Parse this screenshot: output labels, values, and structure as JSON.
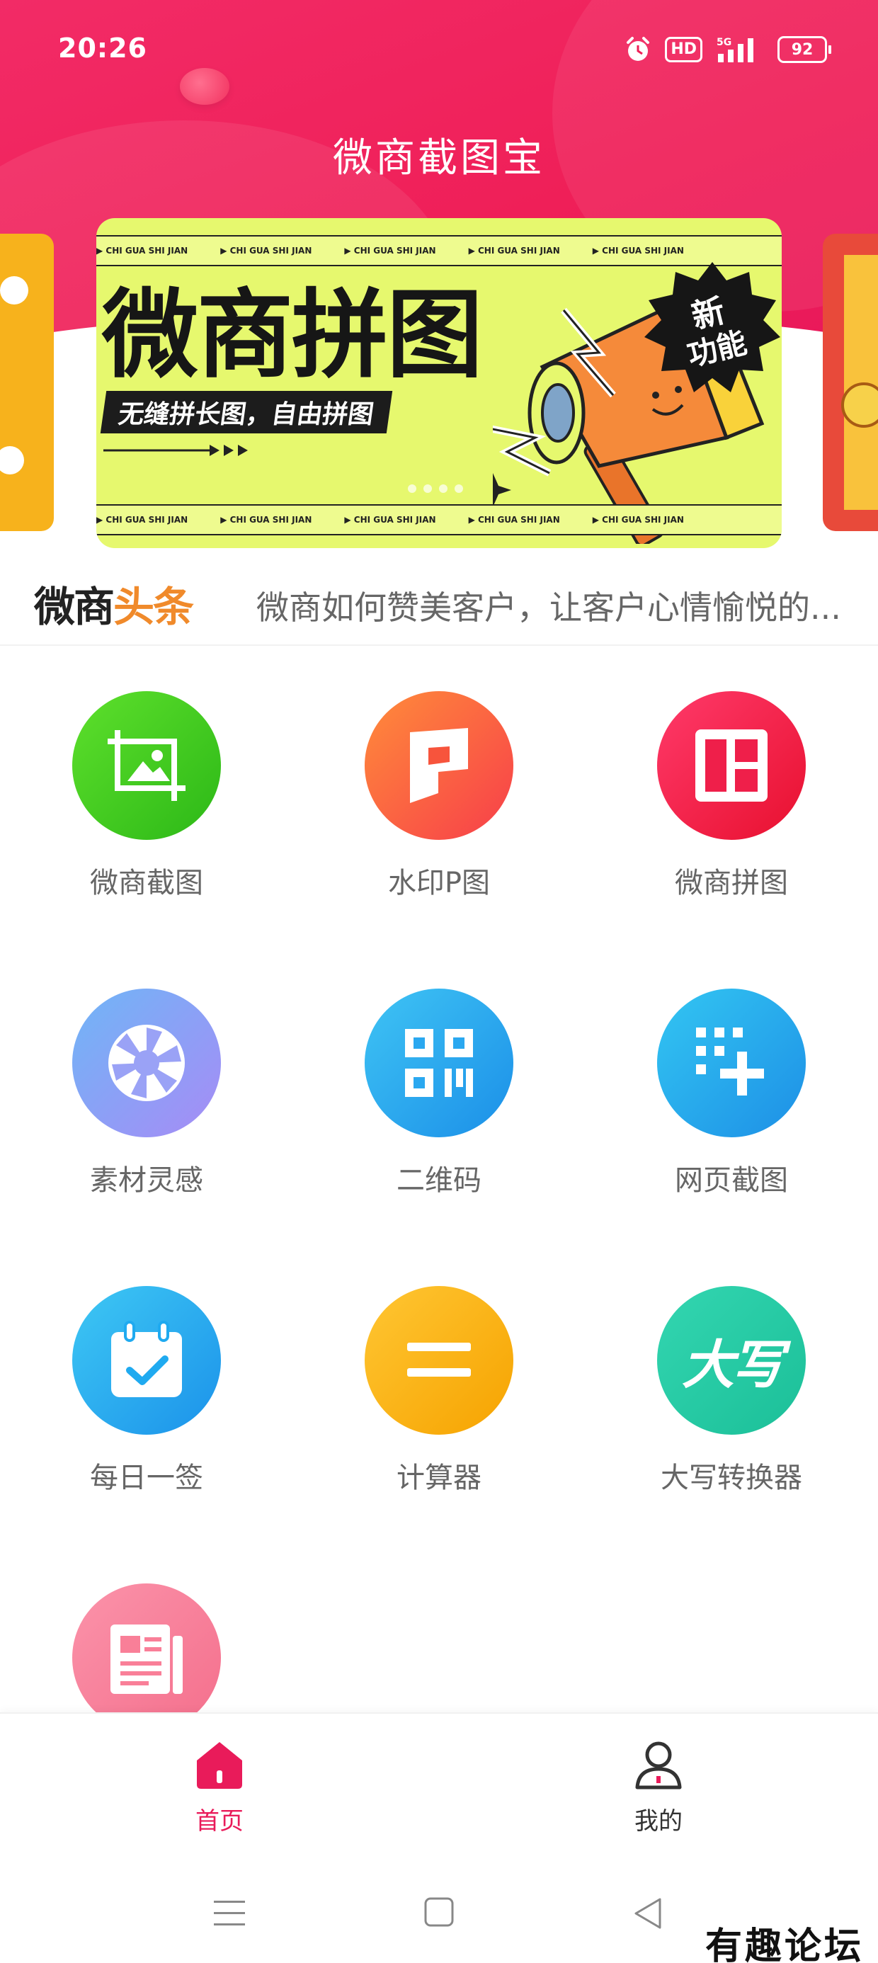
{
  "status_bar": {
    "time": "20:26",
    "hd": "HD",
    "network": "5G",
    "battery": "92"
  },
  "app": {
    "title": "微商截图宝"
  },
  "banner": {
    "headline": "微商拼图",
    "subtitle": "无缝拼长图，自由拼图",
    "badge": "新功能",
    "ticker_items": [
      "CHI GUA SHI JIAN",
      "CHI GUA SHI JIAN",
      "CHI GUA SHI JIAN",
      "CHI GUA SHI JIAN",
      "CHI GUA SHI JIAN"
    ],
    "colors": {
      "background": "#e6f86e",
      "megaphone": "#f58a3a"
    }
  },
  "news": {
    "logo_part1": "微商",
    "logo_part2": "头条",
    "text": "微商如何赞美客户，让客户心情愉悦的..."
  },
  "tools": [
    {
      "label": "微商截图",
      "icon": "image-crop-icon",
      "color": "#3cc81e"
    },
    {
      "label": "水印P图",
      "icon": "watermark-p-icon",
      "color": "#f7543c"
    },
    {
      "label": "微商拼图",
      "icon": "collage-grid-icon",
      "color": "#ef1f4a"
    },
    {
      "label": "素材灵感",
      "icon": "aperture-icon",
      "color": "#8f8ff5"
    },
    {
      "label": "二维码",
      "icon": "qr-code-icon",
      "color": "#2aa8f0"
    },
    {
      "label": "网页截图",
      "icon": "web-capture-icon",
      "color": "#23a8ee"
    },
    {
      "label": "每日一签",
      "icon": "calendar-check-icon",
      "color": "#1faaf0"
    },
    {
      "label": "计算器",
      "icon": "equals-icon",
      "color": "#fbb20f"
    },
    {
      "label": "大写转换器",
      "icon": "uppercase-convert-icon",
      "color": "#22c8a2",
      "icon_text": "大写"
    },
    {
      "label": "",
      "icon": "news-icon",
      "color": "#f97f98"
    }
  ],
  "bottom_nav": {
    "home": "首页",
    "me": "我的",
    "active": "home"
  },
  "watermark": "有趣论坛"
}
